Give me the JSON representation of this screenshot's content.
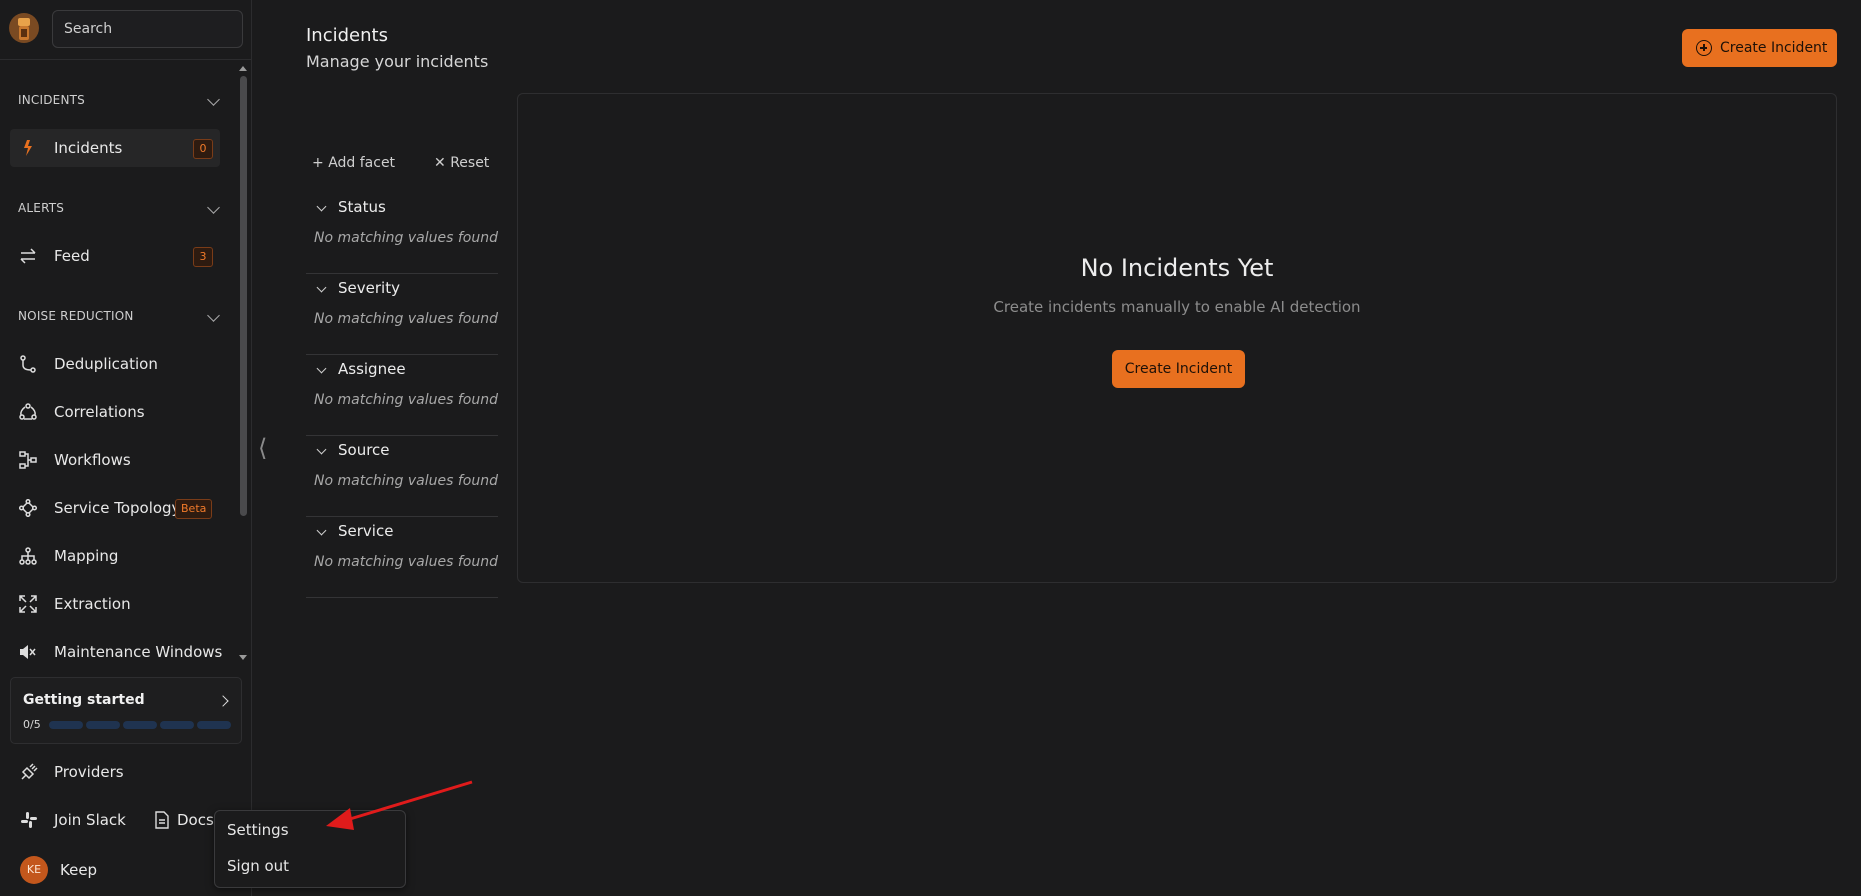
{
  "sidebar": {
    "search_placeholder": "Search",
    "sections": {
      "incidents": "INCIDENTS",
      "alerts": "ALERTS",
      "noise_reduction": "NOISE REDUCTION"
    },
    "items": {
      "incidents": {
        "label": "Incidents",
        "count": "0",
        "icon": "lightning-icon"
      },
      "feed": {
        "label": "Feed",
        "count": "3",
        "icon": "swap-arrows-icon"
      },
      "deduplication": {
        "label": "Deduplication",
        "icon": "merge-icon"
      },
      "correlations": {
        "label": "Correlations",
        "icon": "cycle-nodes-icon"
      },
      "workflows": {
        "label": "Workflows",
        "icon": "workflow-icon"
      },
      "service_topology": {
        "label": "Service Topology",
        "badge": "Beta",
        "icon": "topology-icon"
      },
      "mapping": {
        "label": "Mapping",
        "icon": "hierarchy-icon"
      },
      "extraction": {
        "label": "Extraction",
        "icon": "expand-icon"
      },
      "maintenance_windows": {
        "label": "Maintenance Windows",
        "icon": "speaker-mute-icon"
      }
    },
    "getting_started": {
      "title": "Getting started",
      "progress_text": "0/5",
      "progress_fraction": 0
    },
    "providers": "Providers",
    "join_slack": "Join Slack",
    "docs": "Docs",
    "user": {
      "initials": "KE",
      "name": "Keep"
    }
  },
  "user_menu": {
    "settings": "Settings",
    "sign_out": "Sign out"
  },
  "header": {
    "title": "Incidents",
    "subtitle": "Manage your incidents",
    "create_button": "Create Incident"
  },
  "facets": {
    "add_facet": "Add facet",
    "reset": "Reset",
    "items": [
      {
        "name": "Status",
        "value": "No matching values found"
      },
      {
        "name": "Severity",
        "value": "No matching values found"
      },
      {
        "name": "Assignee",
        "value": "No matching values found"
      },
      {
        "name": "Source",
        "value": "No matching values found"
      },
      {
        "name": "Service",
        "value": "No matching values found"
      }
    ]
  },
  "empty_state": {
    "title": "No Incidents Yet",
    "subtitle": "Create incidents manually to enable AI detection",
    "button": "Create Incident"
  },
  "colors": {
    "accent": "#e8701f",
    "background": "#1b1b1c",
    "annotation_arrow": "#e01b1b"
  }
}
